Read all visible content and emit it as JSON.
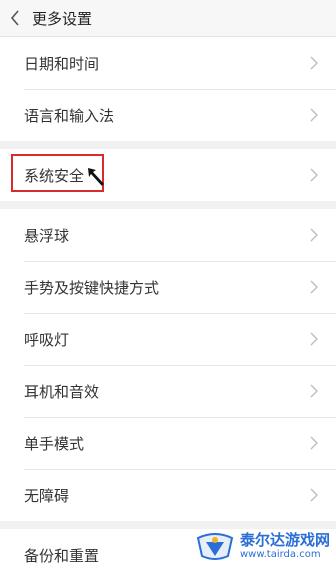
{
  "header": {
    "title": "更多设置"
  },
  "groups": [
    {
      "items": [
        {
          "label": "日期和时间"
        },
        {
          "label": "语言和输入法"
        }
      ]
    },
    {
      "items": [
        {
          "label": "系统安全"
        }
      ]
    },
    {
      "items": [
        {
          "label": "悬浮球"
        },
        {
          "label": "手势及按键快捷方式"
        },
        {
          "label": "呼吸灯"
        },
        {
          "label": "耳机和音效"
        },
        {
          "label": "单手模式"
        },
        {
          "label": "无障碍"
        }
      ]
    },
    {
      "items": [
        {
          "label": "备份和重置"
        }
      ]
    }
  ],
  "icons": {
    "back": "chevron-left-icon",
    "row_arrow": "chevron-right-icon",
    "pointer": "cursor-arrow-icon"
  },
  "colors": {
    "highlight": "#d92b2b",
    "watermark": "#2b6fd6"
  },
  "watermark": {
    "name": "泰尔达游戏网",
    "url": "www.tairda.com"
  }
}
